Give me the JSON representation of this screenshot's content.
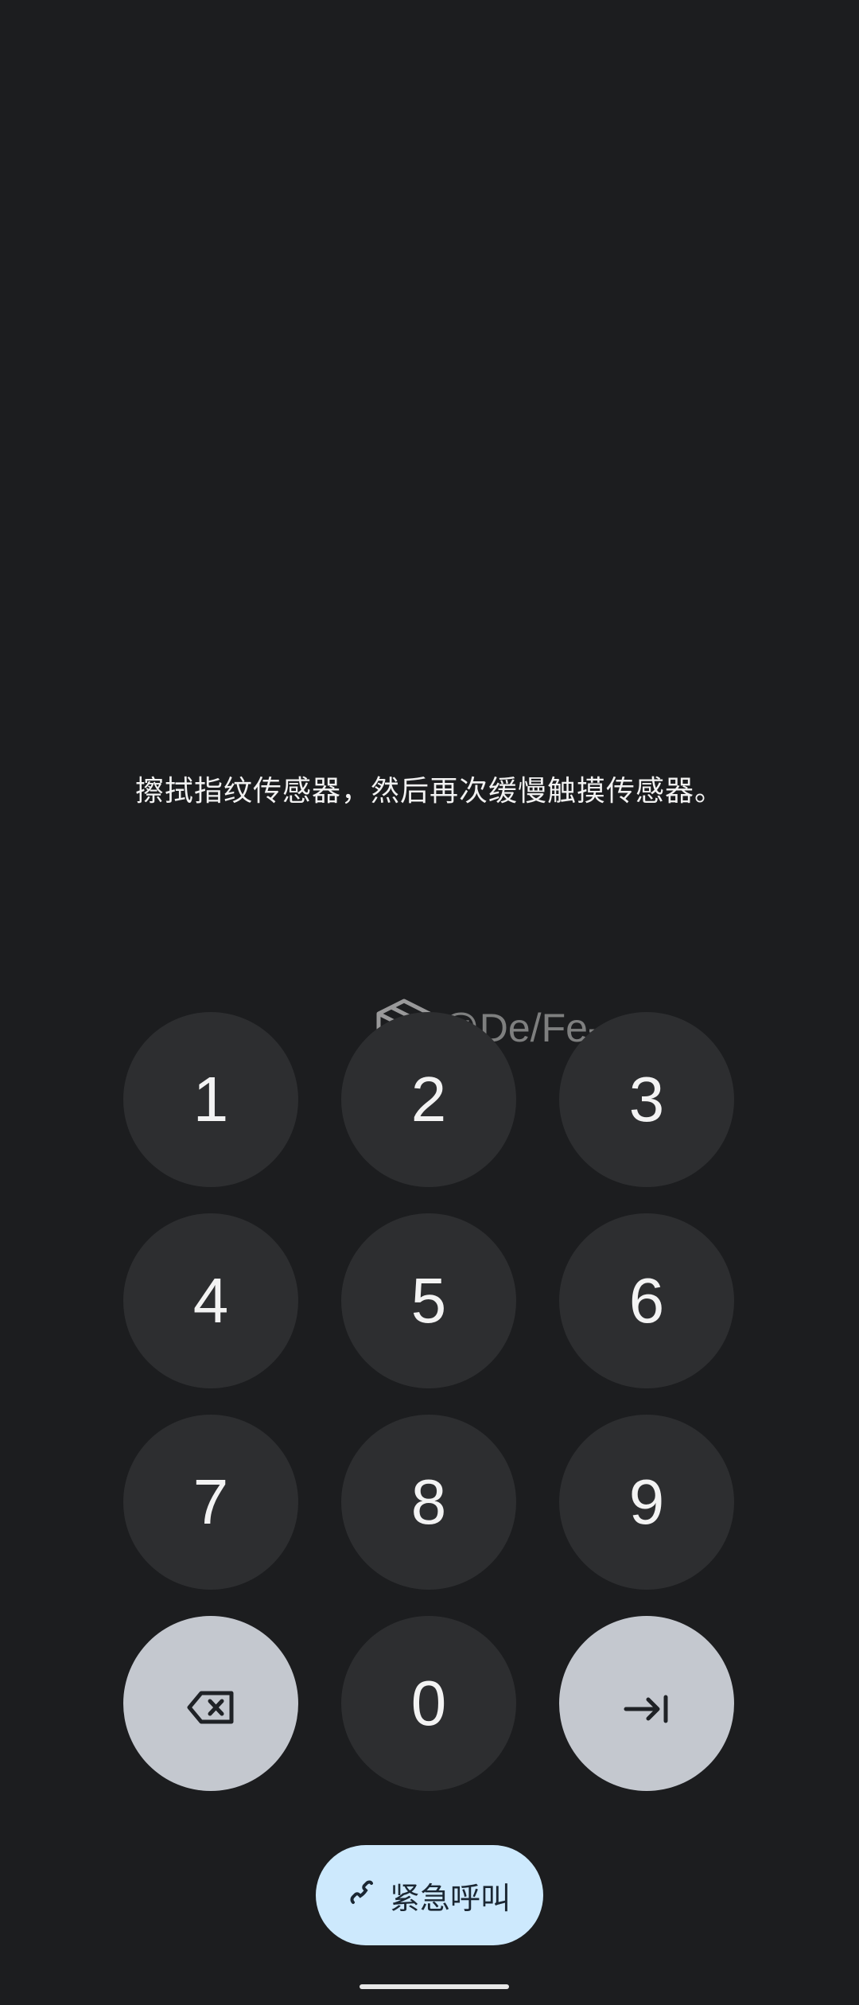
{
  "lockscreen": {
    "message": "擦拭指纹传感器，然后再次缓慢触摸传感器。"
  },
  "watermark": {
    "text": "@De/Fe-",
    "icon": "box-icon"
  },
  "keypad": {
    "keys": [
      "1",
      "2",
      "3",
      "4",
      "5",
      "6",
      "7",
      "8",
      "9",
      "0"
    ],
    "backspace_icon": "backspace-icon",
    "enter_icon": "enter-arrow-icon"
  },
  "emergency": {
    "label": "紧急呼叫",
    "icon": "phone-icon",
    "color": "#cde9fd"
  },
  "colors": {
    "background": "#1c1d1f",
    "key": "#2d2e30",
    "key_light": "#c4c8cf"
  }
}
